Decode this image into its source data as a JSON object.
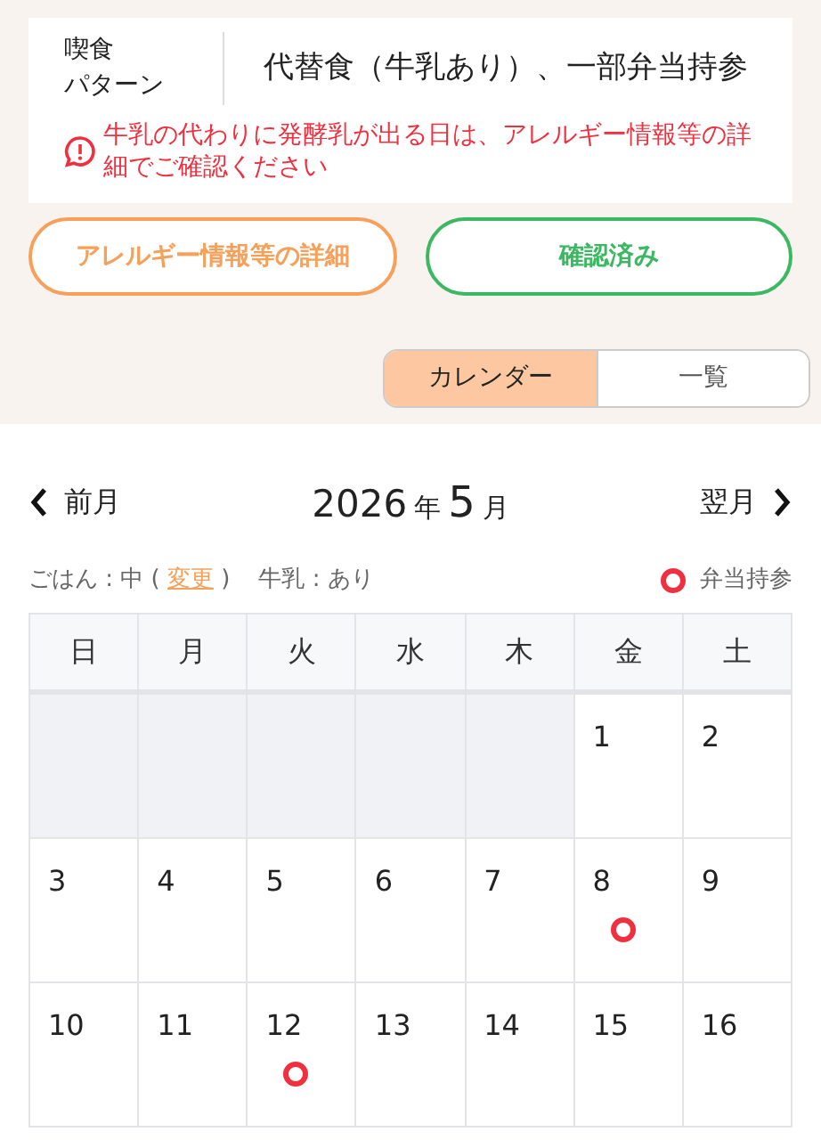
{
  "meal_pattern": {
    "label_lines": [
      "喫食",
      "パターン"
    ],
    "value": "代替食（牛乳あり）、一部弁当持参"
  },
  "notice": "牛乳の代わりに発酵乳が出る日は、アレルギー情報等の詳細でご確認ください",
  "buttons": [
    {
      "label": "アレルギー情報等の詳細",
      "kind": "outline-orange"
    },
    {
      "label": "確認済み",
      "kind": "outline-green"
    }
  ],
  "view_tabs": [
    {
      "label": "カレンダー",
      "selected": true
    },
    {
      "label": "一覧",
      "selected": false
    }
  ],
  "calendar": {
    "prev": "前月",
    "year": "2026",
    "year_unit": "年",
    "month": "5",
    "month_unit": "月",
    "next": "翌月",
    "rice_prefix": "ごはん : 中 (",
    "rice_link": "変更",
    "rice_suffix": ")",
    "milk": "牛乳 : あり",
    "legend": "弁当持参",
    "weekdays": [
      "日",
      "月",
      "火",
      "水",
      "木",
      "金",
      "土"
    ],
    "weeks": [
      [
        {
          "in_month": false
        },
        {
          "in_month": false
        },
        {
          "in_month": false
        },
        {
          "in_month": false
        },
        {
          "in_month": false
        },
        {
          "in_month": true,
          "day": "1",
          "bento": false
        },
        {
          "in_month": true,
          "day": "2",
          "bento": false
        }
      ],
      [
        {
          "in_month": true,
          "day": "3",
          "bento": false
        },
        {
          "in_month": true,
          "day": "4",
          "bento": false
        },
        {
          "in_month": true,
          "day": "5",
          "bento": false
        },
        {
          "in_month": true,
          "day": "6",
          "bento": false
        },
        {
          "in_month": true,
          "day": "7",
          "bento": false
        },
        {
          "in_month": true,
          "day": "8",
          "bento": true
        },
        {
          "in_month": true,
          "day": "9",
          "bento": false
        }
      ],
      [
        {
          "in_month": true,
          "day": "10",
          "bento": false
        },
        {
          "in_month": true,
          "day": "11",
          "bento": false
        },
        {
          "in_month": true,
          "day": "12",
          "bento": true
        },
        {
          "in_month": true,
          "day": "13",
          "bento": false
        },
        {
          "in_month": true,
          "day": "14",
          "bento": false
        },
        {
          "in_month": true,
          "day": "15",
          "bento": false
        },
        {
          "in_month": true,
          "day": "16",
          "bento": false
        }
      ]
    ]
  }
}
